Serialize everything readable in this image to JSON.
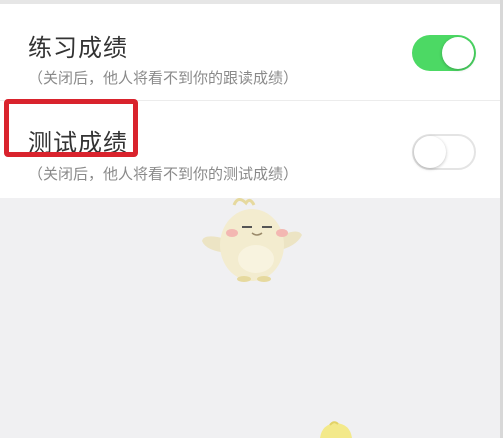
{
  "settings": {
    "practice": {
      "title": "练习成绩",
      "note": "（关闭后，他人将看不到你的跟读成绩）",
      "enabled": true
    },
    "test": {
      "title": "测试成绩",
      "note": "（关闭后，他人将看不到你的测试成绩）",
      "enabled": false
    }
  },
  "colors": {
    "toggle_on": "#4cd964",
    "highlight": "#d9232d",
    "background": "#f0f0f2"
  },
  "icons": {
    "mascot": "chick-mascot-icon"
  }
}
